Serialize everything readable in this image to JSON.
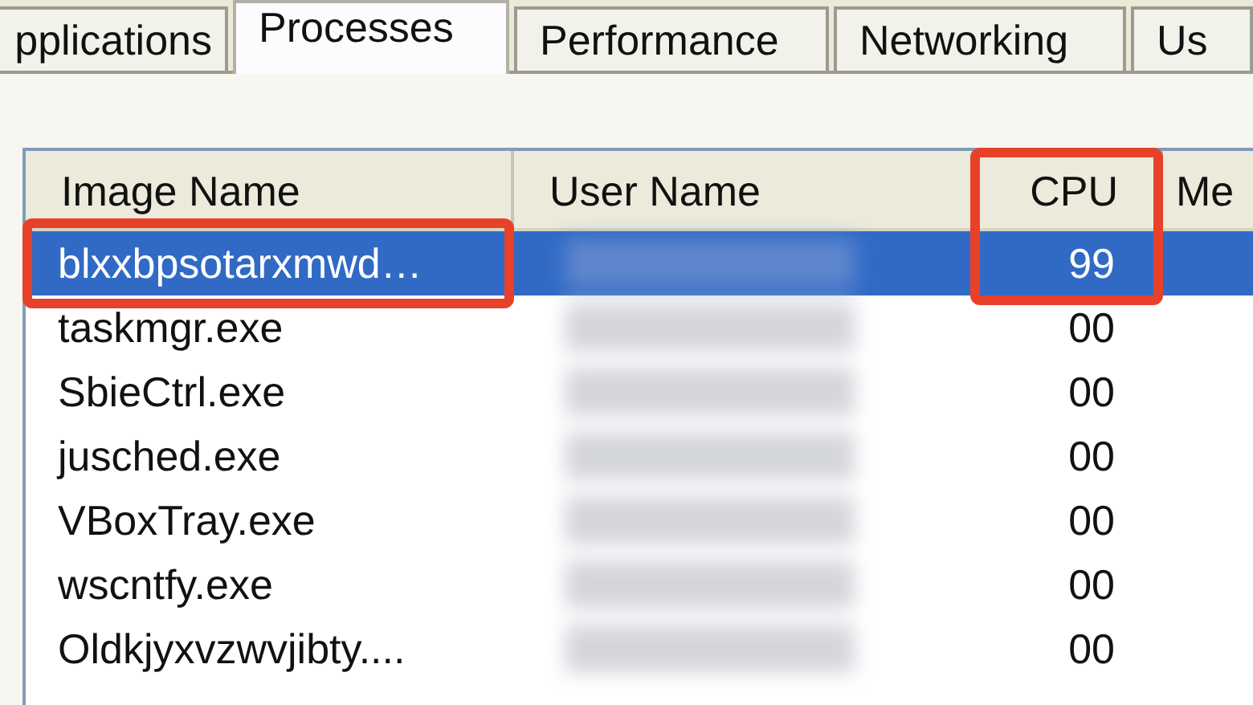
{
  "tabs": [
    {
      "label": "pplications",
      "selected": false
    },
    {
      "label": "Processes",
      "selected": true
    },
    {
      "label": "Performance",
      "selected": false
    },
    {
      "label": "Networking",
      "selected": false
    },
    {
      "label": "Us",
      "selected": false
    }
  ],
  "table": {
    "columns": [
      {
        "label": "Image Name",
        "kind": "name",
        "highlighted": false
      },
      {
        "label": "User Name",
        "kind": "user",
        "highlighted": false
      },
      {
        "label": "CPU",
        "kind": "cpu",
        "highlighted": true
      },
      {
        "label": "Me",
        "kind": "mem",
        "highlighted": false
      }
    ],
    "rows": [
      {
        "image_name": "blxxbpsotarxmwd…",
        "cpu": "99",
        "selected": true,
        "highlighted": true,
        "user_redacted": true
      },
      {
        "image_name": "taskmgr.exe",
        "cpu": "00",
        "selected": false,
        "highlighted": false,
        "user_redacted": true
      },
      {
        "image_name": "SbieCtrl.exe",
        "cpu": "00",
        "selected": false,
        "highlighted": false,
        "user_redacted": true
      },
      {
        "image_name": "jusched.exe",
        "cpu": "00",
        "selected": false,
        "highlighted": false,
        "user_redacted": true
      },
      {
        "image_name": "VBoxTray.exe",
        "cpu": "00",
        "selected": false,
        "highlighted": false,
        "user_redacted": true
      },
      {
        "image_name": "wscntfy.exe",
        "cpu": "00",
        "selected": false,
        "highlighted": false,
        "user_redacted": true
      },
      {
        "image_name": "Oldkjyxvzwvjibty....",
        "cpu": "00",
        "selected": false,
        "highlighted": false,
        "user_redacted": true
      }
    ]
  }
}
